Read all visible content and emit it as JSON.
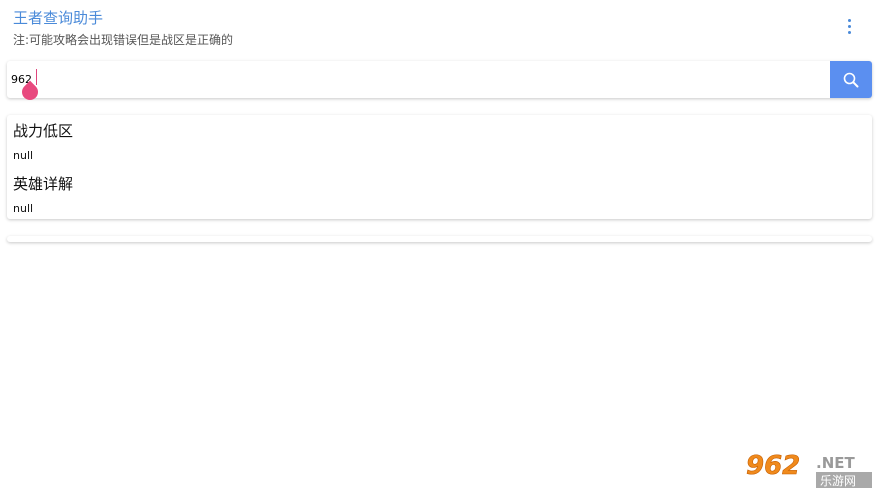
{
  "header": {
    "title": "王者查询助手",
    "subtitle": "注:可能攻略会出现错误但是战区是正确的",
    "more_icon": "more-vertical-icon"
  },
  "search": {
    "value": "962",
    "button_icon": "search-icon"
  },
  "results": [
    {
      "heading": "战力低区",
      "value": "null"
    },
    {
      "heading": "英雄详解",
      "value": "null"
    }
  ],
  "watermark": {
    "number": "962",
    "suffix": ".NET",
    "site": "乐游网"
  },
  "colors": {
    "accent": "#4a8ad9",
    "search_button": "#5b8ff0",
    "caret": "#e8497e"
  }
}
